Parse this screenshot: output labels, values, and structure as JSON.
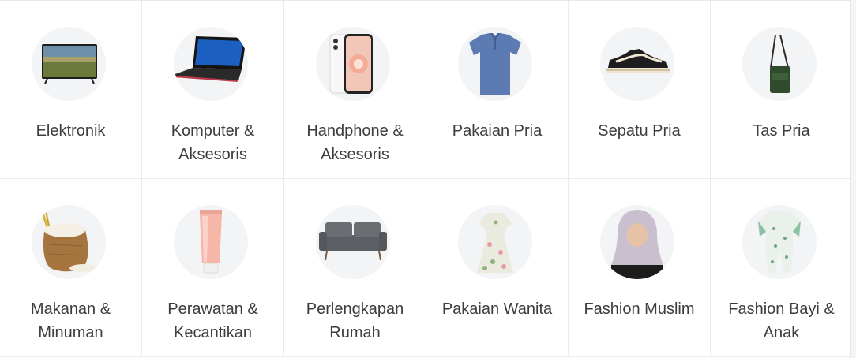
{
  "categories": [
    {
      "label_line1": "Elektronik",
      "label_line2": "",
      "icon": "tv-icon"
    },
    {
      "label_line1": "Komputer &",
      "label_line2": "Aksesoris",
      "icon": "laptop-icon"
    },
    {
      "label_line1": "Handphone &",
      "label_line2": "Aksesoris",
      "icon": "smartphone-icon"
    },
    {
      "label_line1": "Pakaian Pria",
      "label_line2": "",
      "icon": "polo-shirt-icon"
    },
    {
      "label_line1": "Sepatu Pria",
      "label_line2": "",
      "icon": "sneaker-icon"
    },
    {
      "label_line1": "Tas Pria",
      "label_line2": "",
      "icon": "sling-bag-icon"
    },
    {
      "label_line1": "Makanan &",
      "label_line2": "Minuman",
      "icon": "rice-sack-icon"
    },
    {
      "label_line1": "Perawatan &",
      "label_line2": "Kecantikan",
      "icon": "cosmetic-tube-icon"
    },
    {
      "label_line1": "Perlengkapan",
      "label_line2": "Rumah",
      "icon": "sofa-icon"
    },
    {
      "label_line1": "Pakaian Wanita",
      "label_line2": "",
      "icon": "dress-icon"
    },
    {
      "label_line1": "Fashion Muslim",
      "label_line2": "",
      "icon": "hijab-icon"
    },
    {
      "label_line1": "Fashion Bayi &",
      "label_line2": "Anak",
      "icon": "baby-romper-icon"
    }
  ]
}
